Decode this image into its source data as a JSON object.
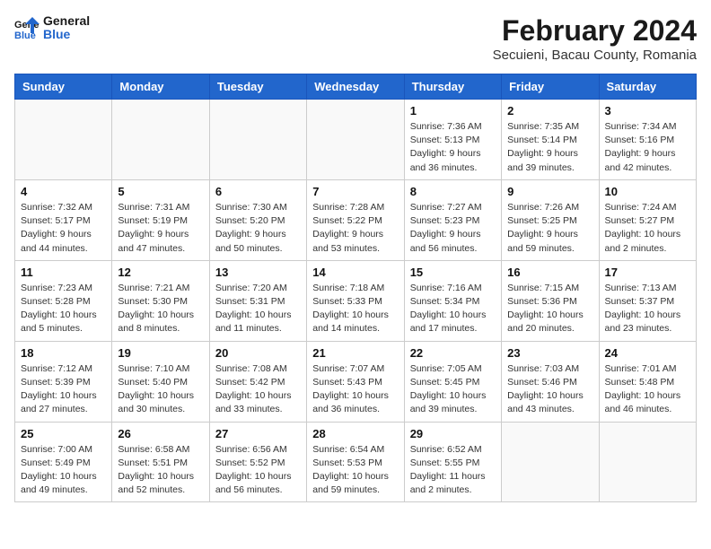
{
  "header": {
    "logo_text_top": "General",
    "logo_text_bottom": "Blue",
    "title": "February 2024",
    "subtitle": "Secuieni, Bacau County, Romania"
  },
  "days_of_week": [
    "Sunday",
    "Monday",
    "Tuesday",
    "Wednesday",
    "Thursday",
    "Friday",
    "Saturday"
  ],
  "weeks": [
    [
      {
        "day": "",
        "sunrise": "",
        "sunset": "",
        "daylight": "",
        "empty": true
      },
      {
        "day": "",
        "sunrise": "",
        "sunset": "",
        "daylight": "",
        "empty": true
      },
      {
        "day": "",
        "sunrise": "",
        "sunset": "",
        "daylight": "",
        "empty": true
      },
      {
        "day": "",
        "sunrise": "",
        "sunset": "",
        "daylight": "",
        "empty": true
      },
      {
        "day": "1",
        "sunrise": "Sunrise: 7:36 AM",
        "sunset": "Sunset: 5:13 PM",
        "daylight": "Daylight: 9 hours and 36 minutes.",
        "empty": false
      },
      {
        "day": "2",
        "sunrise": "Sunrise: 7:35 AM",
        "sunset": "Sunset: 5:14 PM",
        "daylight": "Daylight: 9 hours and 39 minutes.",
        "empty": false
      },
      {
        "day": "3",
        "sunrise": "Sunrise: 7:34 AM",
        "sunset": "Sunset: 5:16 PM",
        "daylight": "Daylight: 9 hours and 42 minutes.",
        "empty": false
      }
    ],
    [
      {
        "day": "4",
        "sunrise": "Sunrise: 7:32 AM",
        "sunset": "Sunset: 5:17 PM",
        "daylight": "Daylight: 9 hours and 44 minutes.",
        "empty": false
      },
      {
        "day": "5",
        "sunrise": "Sunrise: 7:31 AM",
        "sunset": "Sunset: 5:19 PM",
        "daylight": "Daylight: 9 hours and 47 minutes.",
        "empty": false
      },
      {
        "day": "6",
        "sunrise": "Sunrise: 7:30 AM",
        "sunset": "Sunset: 5:20 PM",
        "daylight": "Daylight: 9 hours and 50 minutes.",
        "empty": false
      },
      {
        "day": "7",
        "sunrise": "Sunrise: 7:28 AM",
        "sunset": "Sunset: 5:22 PM",
        "daylight": "Daylight: 9 hours and 53 minutes.",
        "empty": false
      },
      {
        "day": "8",
        "sunrise": "Sunrise: 7:27 AM",
        "sunset": "Sunset: 5:23 PM",
        "daylight": "Daylight: 9 hours and 56 minutes.",
        "empty": false
      },
      {
        "day": "9",
        "sunrise": "Sunrise: 7:26 AM",
        "sunset": "Sunset: 5:25 PM",
        "daylight": "Daylight: 9 hours and 59 minutes.",
        "empty": false
      },
      {
        "day": "10",
        "sunrise": "Sunrise: 7:24 AM",
        "sunset": "Sunset: 5:27 PM",
        "daylight": "Daylight: 10 hours and 2 minutes.",
        "empty": false
      }
    ],
    [
      {
        "day": "11",
        "sunrise": "Sunrise: 7:23 AM",
        "sunset": "Sunset: 5:28 PM",
        "daylight": "Daylight: 10 hours and 5 minutes.",
        "empty": false
      },
      {
        "day": "12",
        "sunrise": "Sunrise: 7:21 AM",
        "sunset": "Sunset: 5:30 PM",
        "daylight": "Daylight: 10 hours and 8 minutes.",
        "empty": false
      },
      {
        "day": "13",
        "sunrise": "Sunrise: 7:20 AM",
        "sunset": "Sunset: 5:31 PM",
        "daylight": "Daylight: 10 hours and 11 minutes.",
        "empty": false
      },
      {
        "day": "14",
        "sunrise": "Sunrise: 7:18 AM",
        "sunset": "Sunset: 5:33 PM",
        "daylight": "Daylight: 10 hours and 14 minutes.",
        "empty": false
      },
      {
        "day": "15",
        "sunrise": "Sunrise: 7:16 AM",
        "sunset": "Sunset: 5:34 PM",
        "daylight": "Daylight: 10 hours and 17 minutes.",
        "empty": false
      },
      {
        "day": "16",
        "sunrise": "Sunrise: 7:15 AM",
        "sunset": "Sunset: 5:36 PM",
        "daylight": "Daylight: 10 hours and 20 minutes.",
        "empty": false
      },
      {
        "day": "17",
        "sunrise": "Sunrise: 7:13 AM",
        "sunset": "Sunset: 5:37 PM",
        "daylight": "Daylight: 10 hours and 23 minutes.",
        "empty": false
      }
    ],
    [
      {
        "day": "18",
        "sunrise": "Sunrise: 7:12 AM",
        "sunset": "Sunset: 5:39 PM",
        "daylight": "Daylight: 10 hours and 27 minutes.",
        "empty": false
      },
      {
        "day": "19",
        "sunrise": "Sunrise: 7:10 AM",
        "sunset": "Sunset: 5:40 PM",
        "daylight": "Daylight: 10 hours and 30 minutes.",
        "empty": false
      },
      {
        "day": "20",
        "sunrise": "Sunrise: 7:08 AM",
        "sunset": "Sunset: 5:42 PM",
        "daylight": "Daylight: 10 hours and 33 minutes.",
        "empty": false
      },
      {
        "day": "21",
        "sunrise": "Sunrise: 7:07 AM",
        "sunset": "Sunset: 5:43 PM",
        "daylight": "Daylight: 10 hours and 36 minutes.",
        "empty": false
      },
      {
        "day": "22",
        "sunrise": "Sunrise: 7:05 AM",
        "sunset": "Sunset: 5:45 PM",
        "daylight": "Daylight: 10 hours and 39 minutes.",
        "empty": false
      },
      {
        "day": "23",
        "sunrise": "Sunrise: 7:03 AM",
        "sunset": "Sunset: 5:46 PM",
        "daylight": "Daylight: 10 hours and 43 minutes.",
        "empty": false
      },
      {
        "day": "24",
        "sunrise": "Sunrise: 7:01 AM",
        "sunset": "Sunset: 5:48 PM",
        "daylight": "Daylight: 10 hours and 46 minutes.",
        "empty": false
      }
    ],
    [
      {
        "day": "25",
        "sunrise": "Sunrise: 7:00 AM",
        "sunset": "Sunset: 5:49 PM",
        "daylight": "Daylight: 10 hours and 49 minutes.",
        "empty": false
      },
      {
        "day": "26",
        "sunrise": "Sunrise: 6:58 AM",
        "sunset": "Sunset: 5:51 PM",
        "daylight": "Daylight: 10 hours and 52 minutes.",
        "empty": false
      },
      {
        "day": "27",
        "sunrise": "Sunrise: 6:56 AM",
        "sunset": "Sunset: 5:52 PM",
        "daylight": "Daylight: 10 hours and 56 minutes.",
        "empty": false
      },
      {
        "day": "28",
        "sunrise": "Sunrise: 6:54 AM",
        "sunset": "Sunset: 5:53 PM",
        "daylight": "Daylight: 10 hours and 59 minutes.",
        "empty": false
      },
      {
        "day": "29",
        "sunrise": "Sunrise: 6:52 AM",
        "sunset": "Sunset: 5:55 PM",
        "daylight": "Daylight: 11 hours and 2 minutes.",
        "empty": false
      },
      {
        "day": "",
        "sunrise": "",
        "sunset": "",
        "daylight": "",
        "empty": true
      },
      {
        "day": "",
        "sunrise": "",
        "sunset": "",
        "daylight": "",
        "empty": true
      }
    ]
  ]
}
